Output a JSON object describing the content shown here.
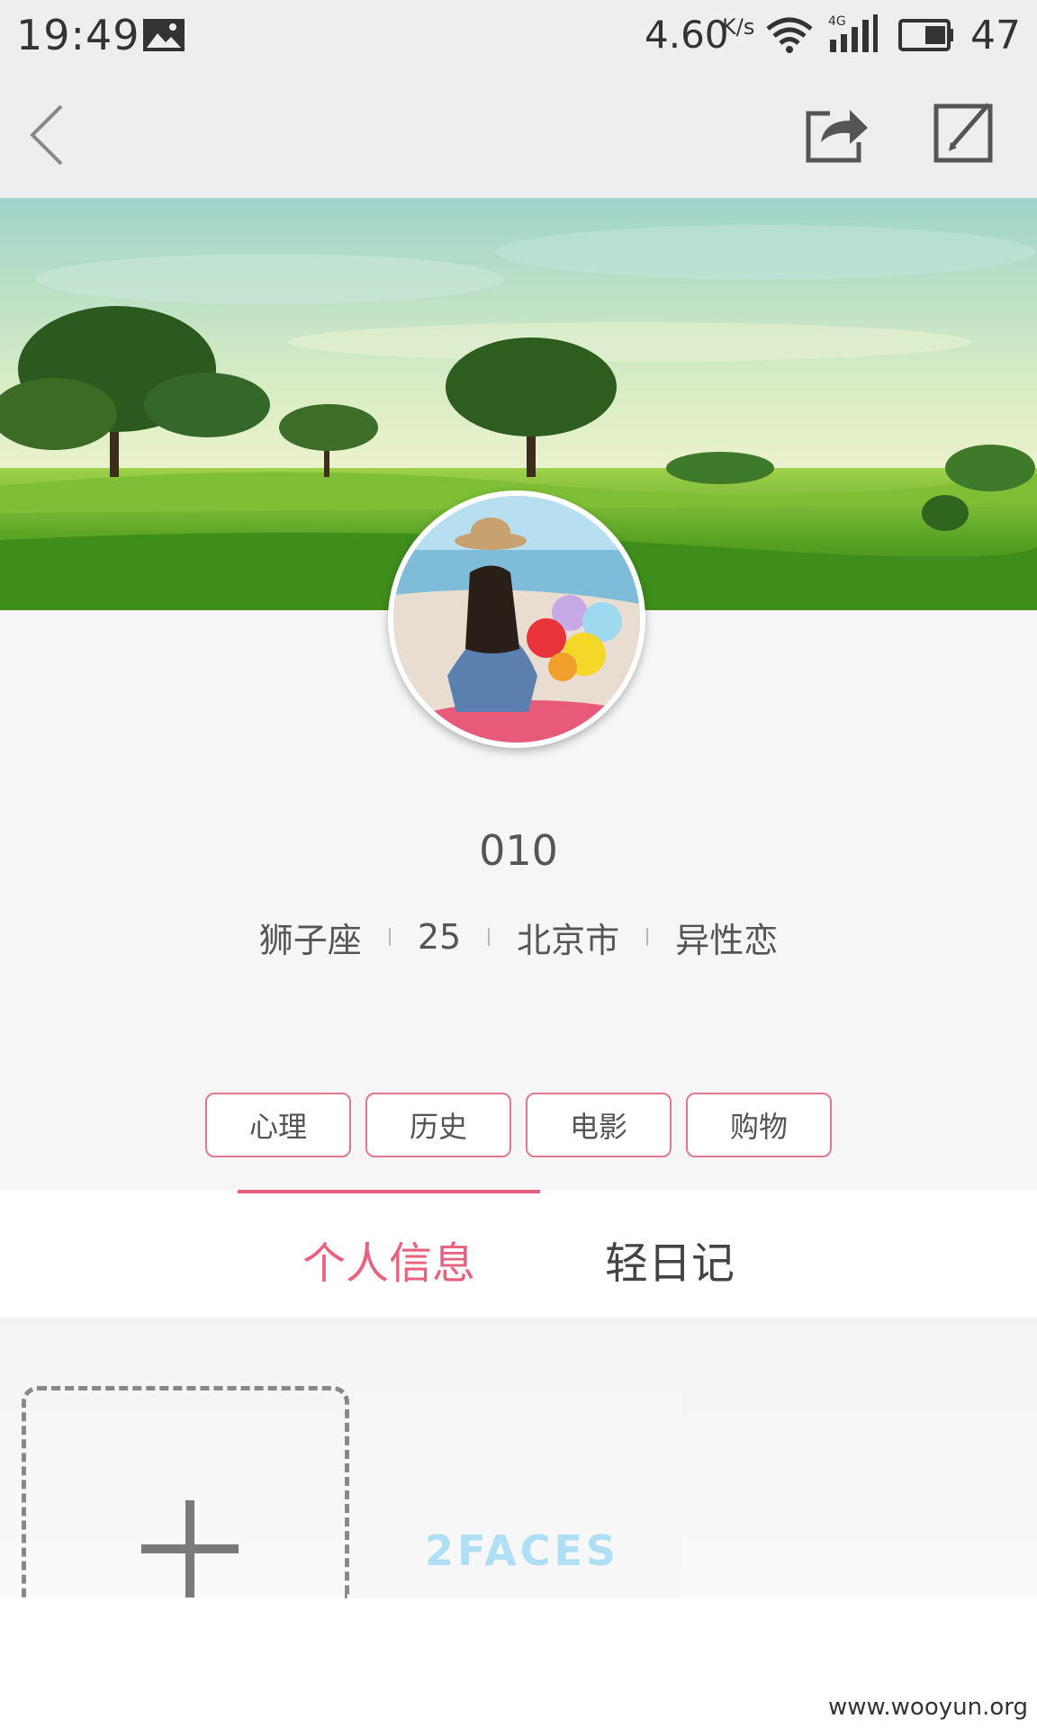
{
  "status_bar": {
    "time": "19:49",
    "network_speed": "4.60",
    "network_speed_unit": "K/s",
    "network_type": "4G",
    "battery_level": "47",
    "icons": [
      "image-icon",
      "wifi-icon",
      "signal-icon",
      "battery-icon"
    ]
  },
  "toolbar": {
    "icons": [
      "back-icon",
      "share-icon",
      "edit-icon"
    ]
  },
  "profile": {
    "username": "010",
    "zodiac": "狮子座",
    "age": "25",
    "city": "北京市",
    "orientation": "异性恋"
  },
  "tags": [
    "心理",
    "历史",
    "电影",
    "购物"
  ],
  "tabs": {
    "personal_info": "个人信息",
    "light_diary": "轻日记",
    "active": "个人信息"
  },
  "content": {
    "brand_logo": "2FACES"
  },
  "watermark": "www.wooyun.org",
  "colors": {
    "accent": "#e8627e",
    "tag_border": "#e2788c",
    "background": "#f6f6f6"
  }
}
